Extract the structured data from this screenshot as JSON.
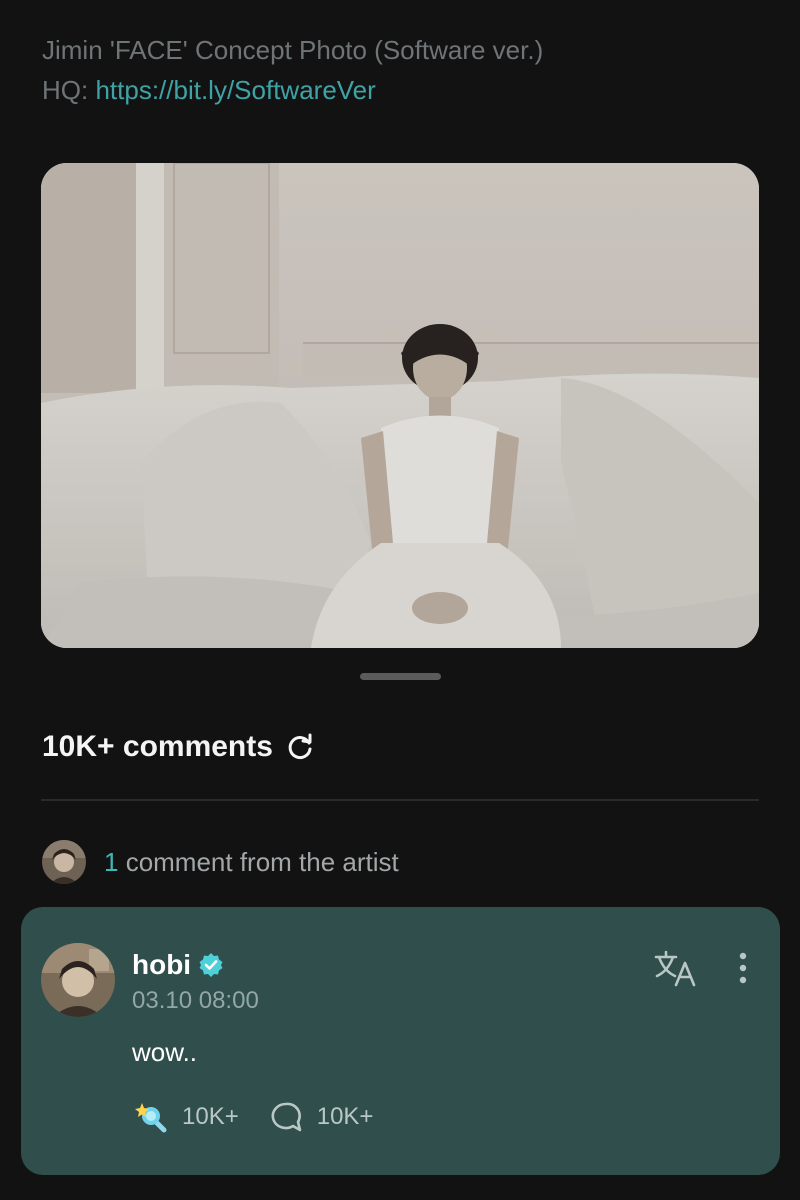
{
  "post": {
    "caption_line1": "Jimin 'FACE' Concept Photo (Software ver.)",
    "caption_hq_label": "HQ: ",
    "caption_link": "https://bit.ly/SoftwareVer"
  },
  "comments": {
    "count_label": "10K+ comments",
    "refresh_icon": "refresh-icon"
  },
  "artist_comments": {
    "count": "1",
    "label": " comment from the artist"
  },
  "artist_comment": {
    "author": "hobi",
    "verified_icon": "verified-check-icon",
    "timestamp": "03.10 08:00",
    "text": "wow..",
    "likes": "10K+",
    "replies": "10K+"
  },
  "colors": {
    "background": "#121212",
    "card": "#2f4e4c",
    "accent": "#3fb7b6",
    "link": "#3fa3a5"
  }
}
